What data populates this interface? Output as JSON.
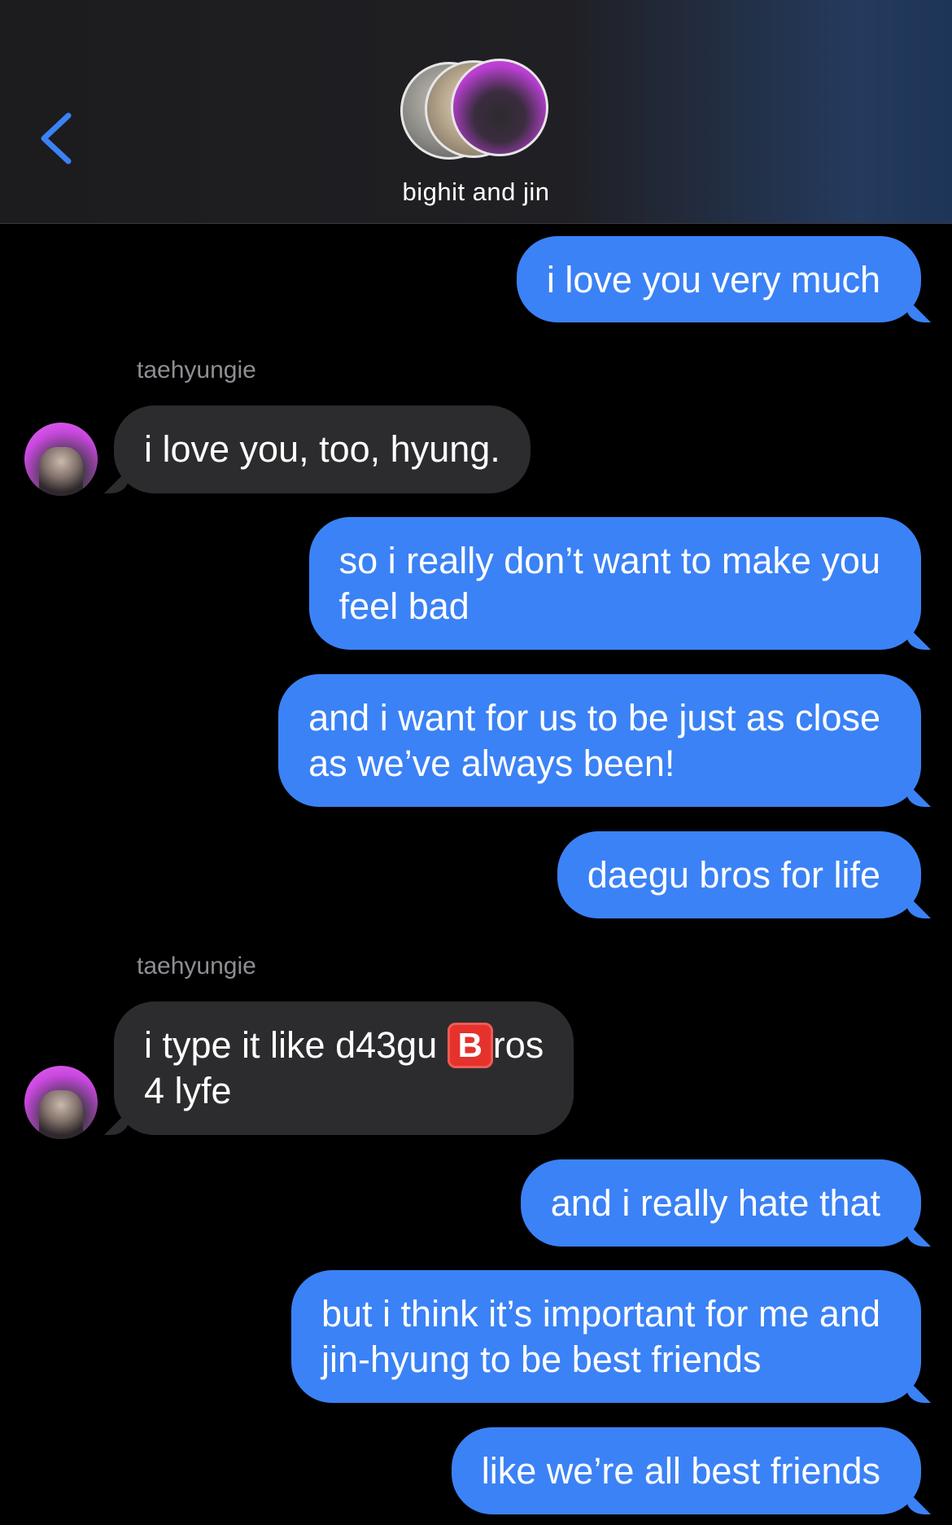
{
  "header": {
    "back_icon": "chevron-left-icon",
    "group_name": "bighit and jin",
    "accent_color": "#3b82f6"
  },
  "messages": [
    {
      "direction": "out",
      "text": "i love you very much"
    },
    {
      "direction": "in",
      "sender": "taehyungie",
      "text": "i love you, too, hyung."
    },
    {
      "direction": "out",
      "text": "so i really don’t want to make you\nfeel bad"
    },
    {
      "direction": "out",
      "text": "and i want for us to be just as close\nas we’ve always been!"
    },
    {
      "direction": "out",
      "text": "daegu bros for life"
    },
    {
      "direction": "in",
      "sender": "taehyungie",
      "text_before": "i type it like d43gu ",
      "emoji": "B",
      "text_after": "ros\n4 lyfe"
    },
    {
      "direction": "out",
      "text": "and i really hate that"
    },
    {
      "direction": "out",
      "text": "but i think it’s important for me and\njin-hyung to be best friends"
    },
    {
      "direction": "out",
      "text": "like we’re all best friends"
    }
  ]
}
